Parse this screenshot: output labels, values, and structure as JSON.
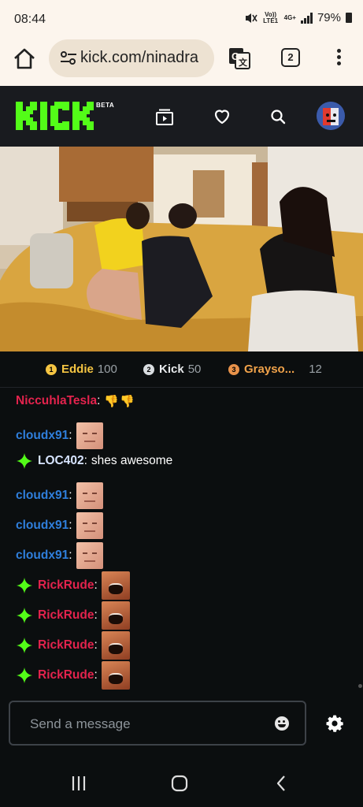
{
  "status_bar": {
    "time": "08:44",
    "volte": "Vo)) LTE1",
    "network": "4G+",
    "battery": "79%"
  },
  "browser": {
    "url": "kick.com/ninadra",
    "tab_count": "2"
  },
  "header": {
    "logo": "KICK",
    "beta": "BETA"
  },
  "leaderboard": [
    {
      "rank": "1",
      "name": "Eddie",
      "count": "100",
      "color": "#f5c542",
      "name_color": "#f5c542"
    },
    {
      "rank": "2",
      "name": "Kick",
      "count": "50",
      "color": "#d9dde0",
      "name_color": "#e8eaec"
    },
    {
      "rank": "3",
      "name": "Grayso...",
      "count": "12",
      "color": "#e8924a",
      "name_color": "#f0a24a"
    }
  ],
  "chat": {
    "messages": [
      {
        "user": "NiccuhlaTesla",
        "color": "#e3234d",
        "badge": false,
        "emote": "thumbs-down",
        "text": "👎👎"
      },
      {
        "user": "cloudx91",
        "color": "#2f7fdc",
        "badge": false,
        "emote": "face",
        "text": ""
      },
      {
        "user": "LOC402",
        "color": "#d7e4ff",
        "badge": true,
        "emote": "",
        "text": "shes awesome"
      },
      {
        "user": "cloudx91",
        "color": "#2f7fdc",
        "badge": false,
        "emote": "face",
        "text": ""
      },
      {
        "user": "cloudx91",
        "color": "#2f7fdc",
        "badge": false,
        "emote": "face",
        "text": ""
      },
      {
        "user": "cloudx91",
        "color": "#2f7fdc",
        "badge": false,
        "emote": "face",
        "text": ""
      },
      {
        "user": "RickRude",
        "color": "#e3234d",
        "badge": true,
        "emote": "scream",
        "text": ""
      },
      {
        "user": "RickRude",
        "color": "#e3234d",
        "badge": true,
        "emote": "scream",
        "text": ""
      },
      {
        "user": "RickRude",
        "color": "#e3234d",
        "badge": true,
        "emote": "scream",
        "text": ""
      },
      {
        "user": "RickRude",
        "color": "#e3234d",
        "badge": true,
        "emote": "scream",
        "text": ""
      }
    ],
    "input_placeholder": "Send a message"
  },
  "colors": {
    "brand_green": "#53fc18",
    "background": "#0b0e0f",
    "header_bg": "#191b1f"
  }
}
